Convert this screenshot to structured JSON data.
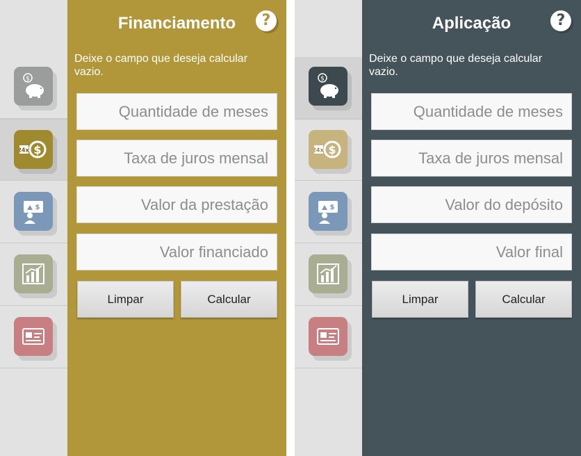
{
  "screens": [
    {
      "title": "Financiamento",
      "help_label": "?",
      "instructions": "Deixe o campo que deseja calcular vazio.",
      "accent": "#b1973a",
      "fields": [
        {
          "placeholder": "Quantidade de meses",
          "value": ""
        },
        {
          "placeholder": "Taxa de juros mensal",
          "value": ""
        },
        {
          "placeholder": "Valor da prestação",
          "value": ""
        },
        {
          "placeholder": "Valor financiado",
          "value": ""
        }
      ],
      "buttons": {
        "clear": "Limpar",
        "calculate": "Calcular"
      },
      "sidebar": {
        "selected_index": 1,
        "items": [
          {
            "icon": "piggy-bank-icon",
            "color": "#9b9d9c"
          },
          {
            "icon": "installments-24x-icon",
            "color": "#9f8a30",
            "badge": "24x"
          },
          {
            "icon": "presentation-money-icon",
            "color": "#7c98b8"
          },
          {
            "icon": "bar-chart-icon",
            "color": "#a9ad92"
          },
          {
            "icon": "credit-card-icon",
            "color": "#c77f82"
          }
        ]
      }
    },
    {
      "title": "Aplicação",
      "help_label": "?",
      "instructions": "Deixe o campo que deseja calcular vazio.",
      "accent": "#44545a",
      "fields": [
        {
          "placeholder": "Quantidade de meses",
          "value": ""
        },
        {
          "placeholder": "Taxa de juros mensal",
          "value": ""
        },
        {
          "placeholder": "Valor do depósito",
          "value": ""
        },
        {
          "placeholder": "Valor final",
          "value": ""
        }
      ],
      "buttons": {
        "clear": "Limpar",
        "calculate": "Calcular"
      },
      "sidebar": {
        "selected_index": 0,
        "items": [
          {
            "icon": "piggy-bank-icon",
            "color": "#3c4a4f"
          },
          {
            "icon": "installments-24x-icon",
            "color": "#c7b37d",
            "badge": "24x"
          },
          {
            "icon": "presentation-money-icon",
            "color": "#7c98b8"
          },
          {
            "icon": "bar-chart-icon",
            "color": "#a9ad92"
          },
          {
            "icon": "credit-card-icon",
            "color": "#c77f82"
          }
        ]
      }
    }
  ]
}
